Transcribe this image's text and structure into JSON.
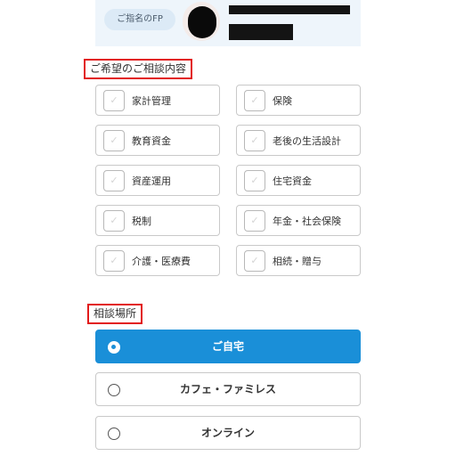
{
  "fp": {
    "label": "ご指名のFP"
  },
  "topics": {
    "title": "ご希望のご相談内容",
    "items": [
      {
        "label": "家計管理",
        "checked": false
      },
      {
        "label": "保険",
        "checked": false
      },
      {
        "label": "教育資金",
        "checked": false
      },
      {
        "label": "老後の生活設計",
        "checked": false
      },
      {
        "label": "資産運用",
        "checked": false
      },
      {
        "label": "住宅資金",
        "checked": false
      },
      {
        "label": "税制",
        "checked": false
      },
      {
        "label": "年金・社会保険",
        "checked": false
      },
      {
        "label": "介護・医療費",
        "checked": false
      },
      {
        "label": "相続・贈与",
        "checked": false
      }
    ],
    "check_glyph": "✓"
  },
  "place": {
    "title": "相談場所",
    "options": [
      {
        "label": "ご自宅",
        "selected": true
      },
      {
        "label": "カフェ・ファミレス",
        "selected": false
      },
      {
        "label": "オンライン",
        "selected": false
      }
    ]
  },
  "colors": {
    "accent": "#1a8fd8",
    "highlight_border": "#e21a1a",
    "card_bg": "#eef5fb"
  },
  "icons": {
    "checkbox": "checkbox-icon",
    "radio": "radio-icon",
    "avatar": "avatar-icon"
  }
}
